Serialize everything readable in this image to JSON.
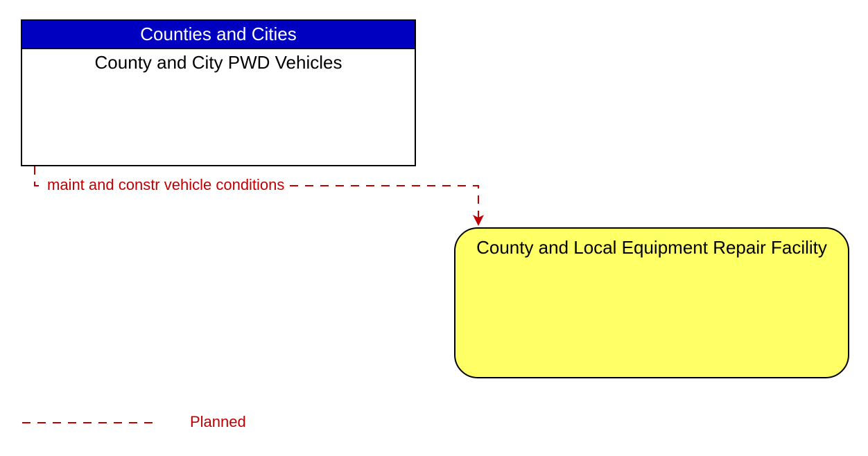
{
  "source_box": {
    "header": "Counties and Cities",
    "title": "County and City PWD Vehicles"
  },
  "target_box": {
    "title": "County and Local Equipment Repair Facility"
  },
  "flow": {
    "label": "maint and constr vehicle conditions"
  },
  "legend": {
    "planned": "Planned"
  },
  "colors": {
    "header_bg": "#0000c0",
    "flow_color": "#c00000",
    "target_fill": "#ffff66"
  }
}
